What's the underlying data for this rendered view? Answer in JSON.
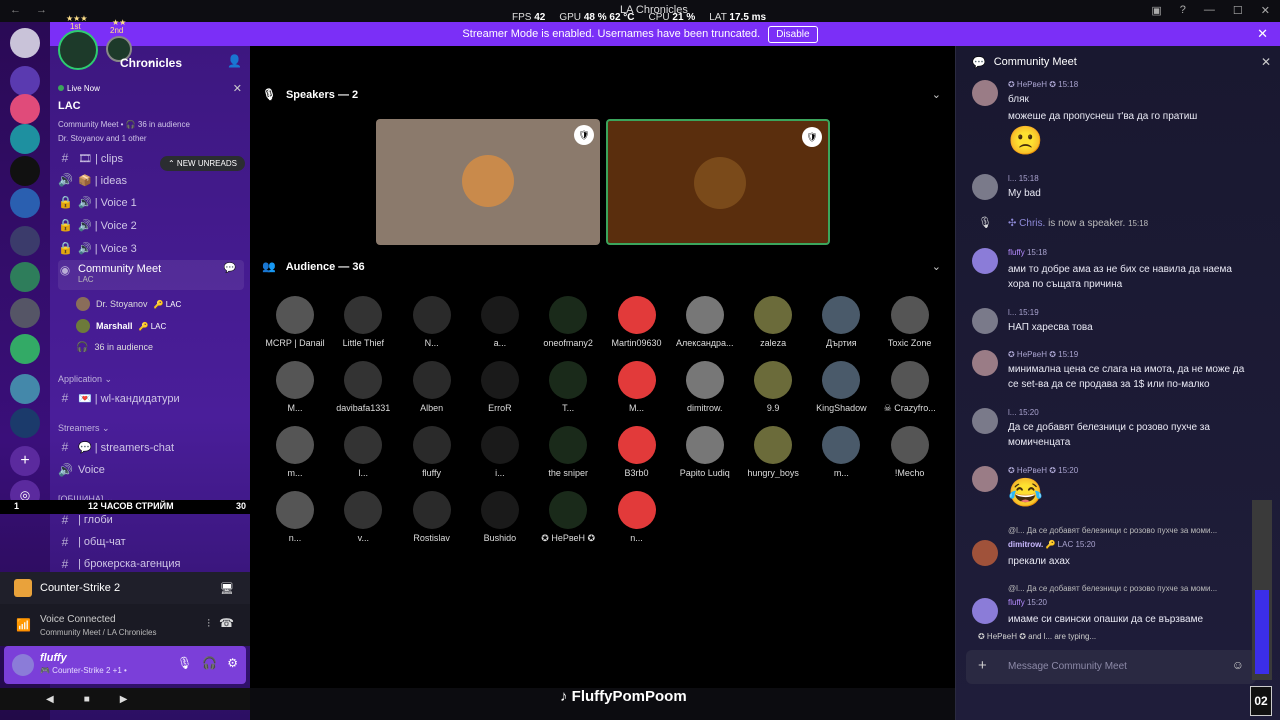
{
  "titlebar": {
    "title": "LA Chronicles",
    "nav": "← →"
  },
  "perf": {
    "fps_label": "FPS",
    "fps": "42",
    "gpu_label": "GPU",
    "gpu": "48 %",
    "gpu_temp": "62 °C",
    "cpu_label": "CPU",
    "cpu": "21 %",
    "lat_label": "LAT",
    "lat": "17.5 ms"
  },
  "banner": {
    "text": "Streamer Mode is enabled. Usernames have been truncated.",
    "button": "Disable"
  },
  "server": {
    "name": "Chronicles",
    "ranks": [
      {
        "stars": "★★★",
        "label": "1st"
      },
      {
        "stars": "★★",
        "label": "2nd"
      }
    ]
  },
  "live": {
    "status": "Live Now",
    "name": "LAC",
    "meta": "Community Meet • 🎧 36 in audience",
    "people": "Dr. Stoyanov and 1 other"
  },
  "unread_pill": "⌃ NEW UNREADS",
  "channels_top": [
    {
      "icon": "#",
      "label": "🎞 | clips"
    },
    {
      "icon": "🔊",
      "label": "📦 | ideas"
    },
    {
      "icon": "🔒",
      "label": "🔊 | Voice 1"
    },
    {
      "icon": "🔒",
      "label": "🔊 | Voice 2"
    },
    {
      "icon": "🔒",
      "label": "🔊 | Voice 3"
    }
  ],
  "stage_channel": {
    "name": "Community Meet",
    "sub": "LAC"
  },
  "stage_members": [
    {
      "name": "Dr. Stoyanov",
      "tag": "🔑 LAC"
    },
    {
      "name": "Marshall",
      "tag": "🔑 LAC"
    },
    {
      "name": "36 in audience",
      "tag": ""
    }
  ],
  "cat_application": "Application ⌄",
  "ch_application": "💌 | wl-кандидатури",
  "cat_streamers": "Streamers ⌄",
  "ch_streamers_chat": "💬 | streamers-chat",
  "ch_voice": "Voice",
  "cat_community": "[ОБЩИНА] ⌄",
  "strip": {
    "left": "1",
    "center": "12 ЧАСОВ СТРИЙМ",
    "right": "30"
  },
  "ch_community": [
    {
      "icon": "#",
      "label": "| глоби"
    },
    {
      "icon": "#",
      "label": "| общ-чат"
    },
    {
      "icon": "#",
      "label": "| брокерска-агенция"
    }
  ],
  "game": "Counter-Strike 2",
  "voice": {
    "status": "Voice Connected",
    "where": "Community Meet / LA Chronicles"
  },
  "user": {
    "name": "fluffy",
    "status": "🎮 Counter-Strike 2 +1 •"
  },
  "speakers_title": "Speakers — 2",
  "audience_title": "Audience — 36",
  "audience": [
    "MCRP | Danail",
    "Little Thief",
    "N...",
    "a...",
    "oneofmany2",
    "Martin09630",
    "Александра...",
    "zaleza",
    "Дъртия",
    "Toxic Zone",
    "M...",
    "davibafa1331",
    "Alben",
    "ErroR",
    "T...",
    "M...",
    "dimitrow.",
    "9.9",
    "KingShadow",
    "☠ Crazyfro...",
    "m...",
    "l...",
    "fluffy",
    "i...",
    "the sniper",
    "B3rb0",
    "Papito Ludiq",
    "hungry_boys",
    "m...",
    "!Mecho",
    "n...",
    "v...",
    "Rostislav",
    "Bushido",
    "✪ НеРвеН ✪",
    "n..."
  ],
  "chat": {
    "title": "Community Meet",
    "messages": [
      {
        "author": "✪ HePвeH ✪",
        "time": "15:18",
        "lines": [
          "бляк",
          "можеше да пропуснеш т'ва да го пратиш"
        ]
      },
      {
        "author": "l...",
        "time": "15:18",
        "lines": [
          "My bad"
        ]
      },
      {
        "author": "✣ Chris.",
        "time": "15:18",
        "lines": [
          "is now a speaker."
        ]
      },
      {
        "author": "fluffy",
        "time": "15:18",
        "lines": [
          "ами то добре ама аз не бих се навила да наема",
          "хора по същата причина"
        ]
      },
      {
        "author": "l...",
        "time": "15:19",
        "lines": [
          "НАП харесва това"
        ]
      },
      {
        "author": "✪ HePвeH ✪",
        "time": "15:19",
        "lines": [
          "минимална цена се слага на имота, да не може да",
          "се set-ва да се продава за 1$ или по-малко"
        ]
      },
      {
        "author": "l...",
        "time": "15:20",
        "lines": [
          "Да се добавят белезници с розово пухче за",
          "момиченцата"
        ]
      },
      {
        "author": "✪ HePвeH ✪",
        "time": "15:20",
        "lines": []
      },
      {
        "author": "dimitrow.",
        "time": "15:20",
        "lines": [
          "прекали ахах"
        ]
      },
      {
        "author": "fluffy",
        "time": "15:20",
        "lines": [
          "имаме си свински опашки да се вързваме"
        ]
      }
    ],
    "reply_1": "@l... Да се добавят белезници с розово пухче за моми...",
    "reply_2": "@l... Да се добавят белезници с розово пухче за моми...",
    "typing": "✪ HePвeH ✪ and l... are typing...",
    "placeholder": "Message Community Meet"
  },
  "brand": "FluffyPomPoom",
  "counter": "02",
  "tag_lac": "🔑 LAC",
  "colors": {
    "banner": "#7b2ff7",
    "sidebar": "#4a1e9a",
    "accent_green": "#2ecc71"
  }
}
